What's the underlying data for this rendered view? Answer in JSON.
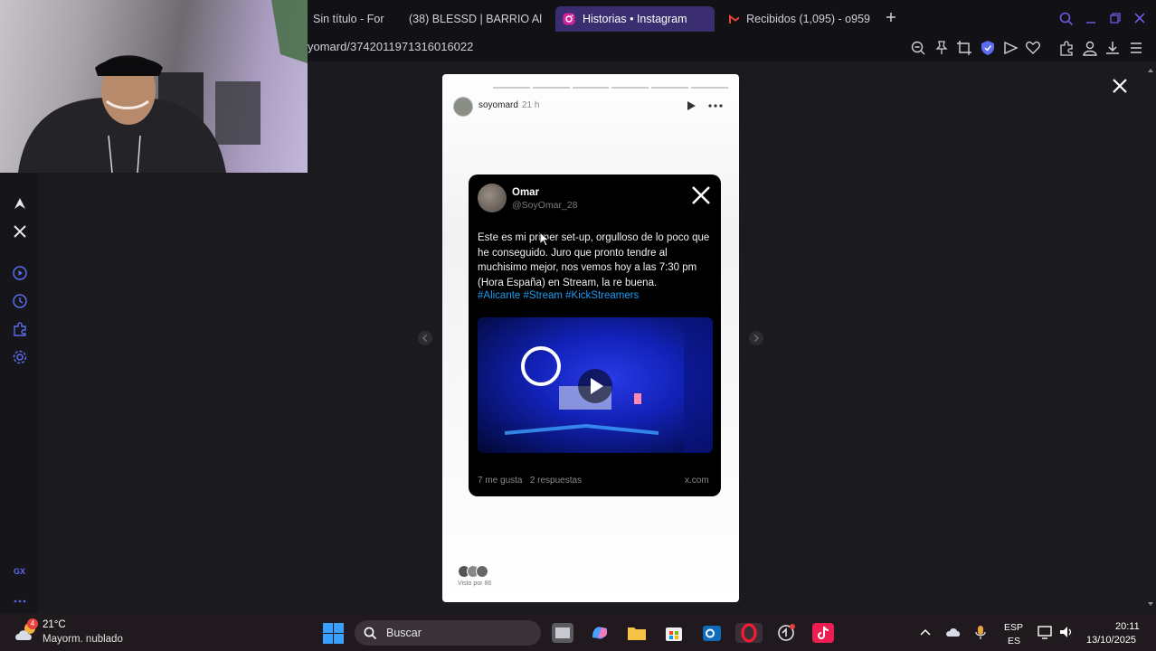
{
  "tabs": [
    {
      "label": "Sin título - For",
      "active": false,
      "icon": "doc-icon"
    },
    {
      "label": "(38) BLESSD | BARRIO Al",
      "active": false,
      "icon": "youtube-icon"
    },
    {
      "label": "Historias • Instagram",
      "active": true,
      "icon": "instagram-icon"
    },
    {
      "label": "Recibidos (1,095) - o959",
      "active": false,
      "icon": "gmail-icon"
    }
  ],
  "address": {
    "url": "yomard/3742011971316016022"
  },
  "story": {
    "username": "soyomard",
    "time": "21 h",
    "viewers": "Visto por 86",
    "segments": 7,
    "segments_done": 1
  },
  "tweet": {
    "name": "Omar",
    "handle": "@SoyOmar_28",
    "text": "Este es mi primer set-up, orgulloso de lo poco que he conseguido. Juro que pronto tendre al muchisimo mejor, nos vemos hoy a las 7:30 pm (Hora España) en Stream, la re buena.",
    "hashtags": "#Alicante #Stream #KickStreamers",
    "likes": "7 me gusta",
    "replies": "2 respuestas",
    "source": "x.com"
  },
  "taskbar": {
    "temperature": "21°C",
    "weather": "Mayorm. nublado",
    "weather_badge": "4",
    "search_placeholder": "Buscar",
    "lang_top": "ESP",
    "lang_bottom": "ES",
    "time": "20:11",
    "date": "13/10/2025"
  },
  "sidebar": {
    "gx_label": "GX"
  },
  "colors": {
    "accent": "#3a2e70",
    "link": "#1d9bf0",
    "opera": "#ff1b2d"
  }
}
